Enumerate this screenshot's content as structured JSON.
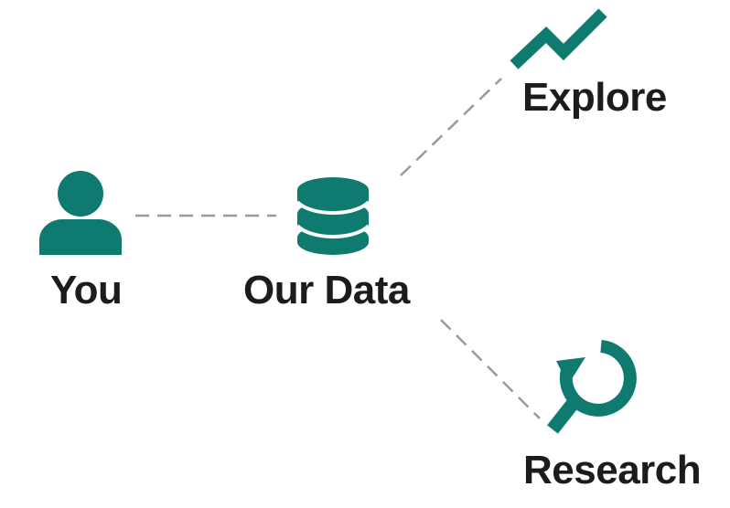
{
  "colors": {
    "accent": "#0f7b70",
    "connector": "#9a9a9a",
    "text": "#1c1c1c"
  },
  "nodes": {
    "you": {
      "label": "You",
      "icon": "person-icon"
    },
    "data": {
      "label": "Our Data",
      "icon": "database-icon"
    },
    "explore": {
      "label": "Explore",
      "icon": "trend-line-icon"
    },
    "research": {
      "label": "Research",
      "icon": "magnifier-refresh-icon"
    }
  },
  "edges": [
    {
      "from": "you",
      "to": "data"
    },
    {
      "from": "data",
      "to": "explore"
    },
    {
      "from": "data",
      "to": "research"
    }
  ]
}
